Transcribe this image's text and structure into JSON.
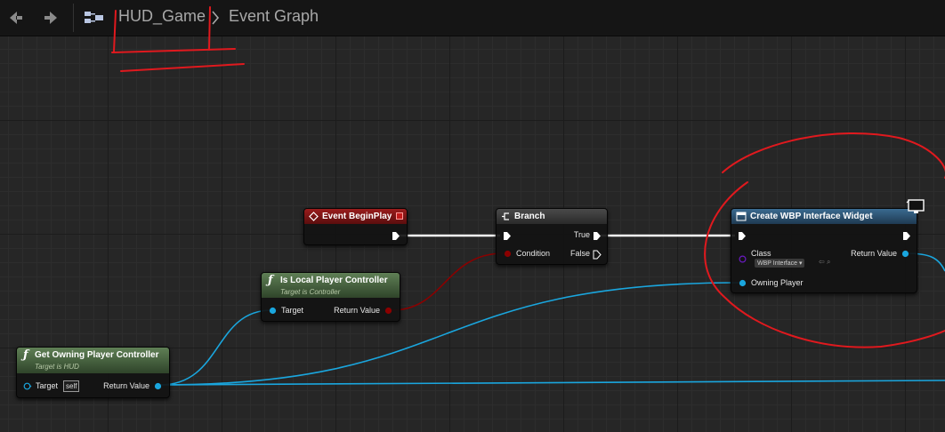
{
  "breadcrumb": {
    "asset": "HUD_Game",
    "graph": "Event Graph"
  },
  "icons": {
    "back": "arrow-left-icon",
    "forward": "arrow-right-icon",
    "graph": "blueprint-graph-icon"
  },
  "nodes": {
    "event_begin_play": {
      "title": "Event BeginPlay"
    },
    "branch": {
      "title": "Branch",
      "condition": "Condition",
      "true_label": "True",
      "false_label": "False"
    },
    "create_widget": {
      "title": "Create WBP Interface Widget",
      "class_label": "Class",
      "class_value": "WBP Interface",
      "owning_player": "Owning Player",
      "return_value": "Return Value"
    },
    "is_local_pc": {
      "title": "Is Local Player Controller",
      "subtitle": "Target is Controller",
      "target": "Target",
      "return_value": "Return Value"
    },
    "get_owning_pc": {
      "title": "Get Owning Player Controller",
      "subtitle": "Target is HUD",
      "target": "Target",
      "self_value": "self",
      "return_value": "Return Value"
    }
  },
  "colors": {
    "event_header": "#8b1515",
    "branch_header": "#3c3c3c",
    "create_header": "#2c4f6e",
    "function_header": "#4e6b45",
    "exec_wire": "#ffffff",
    "object_wire": "#1aa6de",
    "bool_wire": "#8b0000",
    "annotation": "#e0191e"
  }
}
